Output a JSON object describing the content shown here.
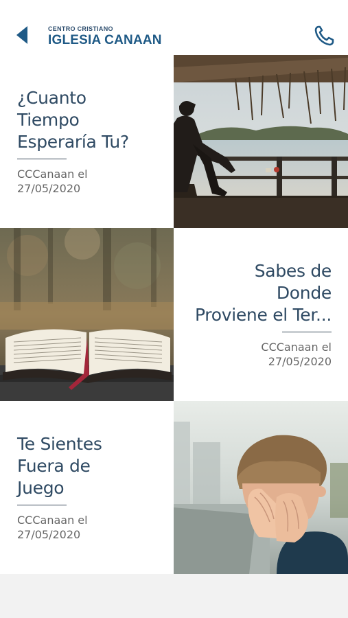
{
  "header": {
    "logo_small": "CENTRO CRISTIANO",
    "logo_big": "IGLESIA CANAAN",
    "back_icon": "back-arrow-icon",
    "phone_icon": "phone-icon"
  },
  "colors": {
    "primary": "#1f5a86",
    "title_text": "#2f4a63",
    "meta_text": "#666666",
    "background": "#f2f2f2"
  },
  "posts": [
    {
      "title_lines": [
        "¿Cuanto",
        "Tiempo",
        "Esperaría Tu?"
      ],
      "author": "CCCanaan el",
      "date": "27/05/2020",
      "image": "man sitting on pier overlooking sea"
    },
    {
      "title_lines": [
        "Sabes de",
        "Donde",
        "Proviene el Ter..."
      ],
      "author": "CCCanaan el",
      "date": "27/05/2020",
      "image": "open bible on stone"
    },
    {
      "title_lines": [
        "Te Sientes",
        "Fuera de",
        "Juego"
      ],
      "author": "CCCanaan el",
      "date": "27/05/2020",
      "image": "young man covering face with hands"
    }
  ]
}
